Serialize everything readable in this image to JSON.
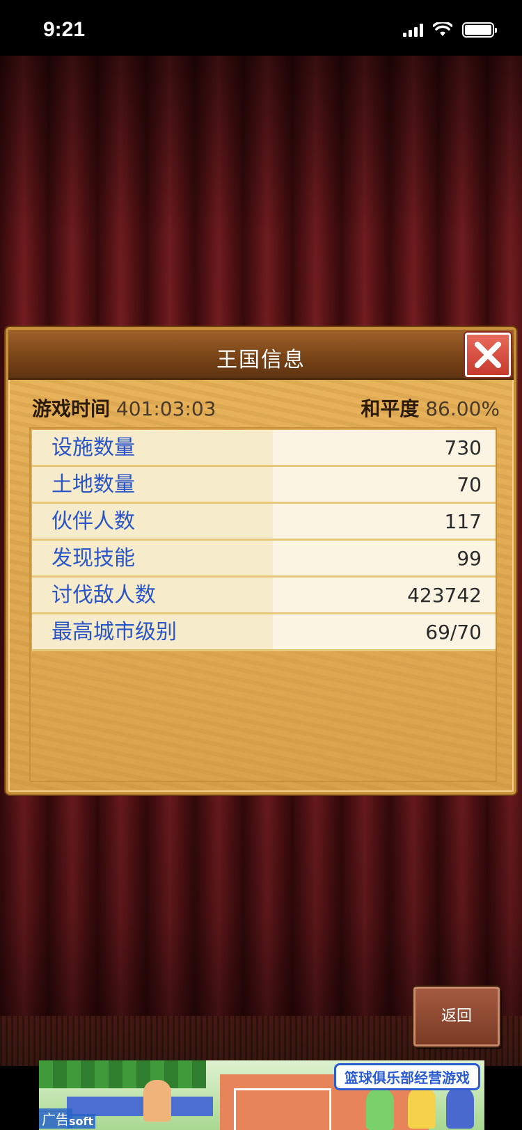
{
  "status_bar": {
    "time": "9:21"
  },
  "dialog": {
    "title": "王国信息",
    "game_time_label": "游戏时间",
    "game_time_value": "401:03:03",
    "peace_label": "和平度",
    "peace_value": "86.00%",
    "stats": [
      {
        "name": "设施数量",
        "value": "730"
      },
      {
        "name": "土地数量",
        "value": "70"
      },
      {
        "name": "伙伴人数",
        "value": "117"
      },
      {
        "name": "发现技能",
        "value": "99"
      },
      {
        "name": "讨伐敌人数",
        "value": "423742"
      },
      {
        "name": "最高城市级别",
        "value": "69/70"
      }
    ]
  },
  "back_button": {
    "label": "返回"
  },
  "ad": {
    "headline": "篮球俱乐部经营游戏",
    "tag": "广告",
    "brand": "soft"
  },
  "icons": {
    "close": "close-icon",
    "signal": "cellular-signal-icon",
    "wifi": "wifi-icon",
    "battery": "battery-icon"
  },
  "colors": {
    "stat_name": "#2a55c8",
    "close_red": "#c73a2e",
    "header_brown": "#7a4518"
  }
}
